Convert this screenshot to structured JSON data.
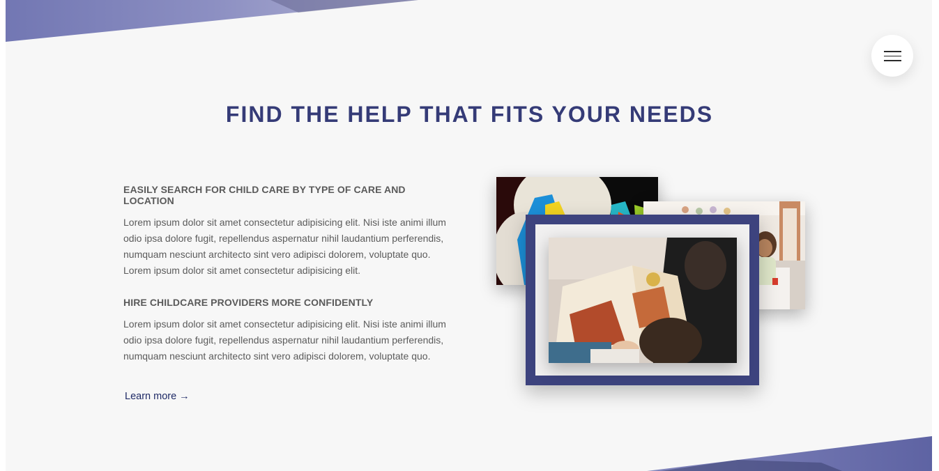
{
  "section": {
    "heading": "FIND THE HELP THAT FITS YOUR NEEDS",
    "accent_color": "#353b77",
    "background_color": "#f7f7f7"
  },
  "nav": {
    "menu_icon": "hamburger-menu-icon"
  },
  "features": [
    {
      "title": "EASILY SEARCH FOR CHILD CARE BY TYPE OF CARE AND LOCATION",
      "body": "Lorem ipsum dolor sit amet consectetur adipisicing elit. Nisi iste animi illum odio ipsa dolore fugit, repellendus aspernatur nihil laudantium perferendis, numquam nesciunt architecto sint vero adipisci dolorem, voluptate quo. Lorem ipsum dolor sit amet consectetur adipisicing elit."
    },
    {
      "title": "HIRE CHILDCARE PROVIDERS MORE CONFIDENTLY",
      "body": "Lorem ipsum dolor sit amet consectetur adipisicing elit. Nisi iste animi illum odio ipsa dolore fugit, repellendus aspernatur nihil laudantium perferendis, numquam nesciunt architecto sint vero adipisci dolorem, voluptate quo."
    }
  ],
  "cta": {
    "label": "Learn more →"
  },
  "gallery": {
    "frame_color": "#3d437e"
  }
}
